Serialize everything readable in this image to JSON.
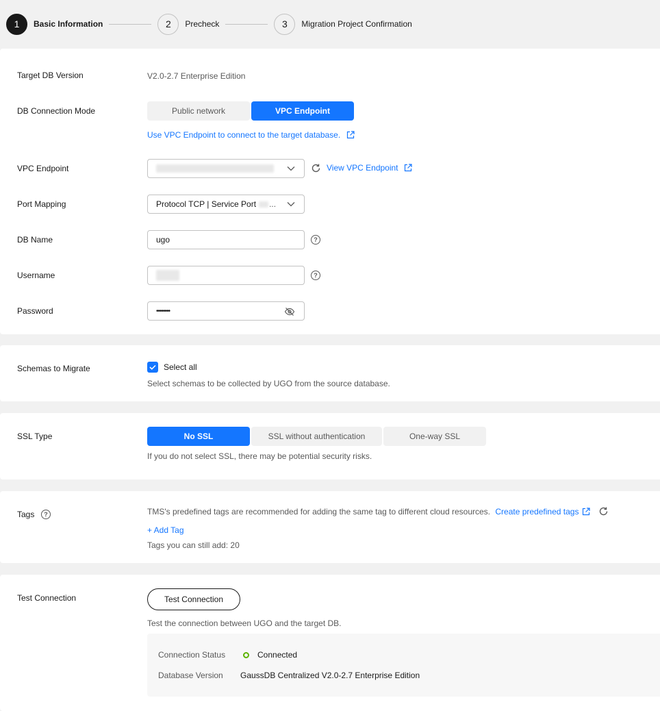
{
  "steps": [
    {
      "num": "1",
      "label": "Basic Information"
    },
    {
      "num": "2",
      "label": "Precheck"
    },
    {
      "num": "3",
      "label": "Migration Project Confirmation"
    }
  ],
  "target_db": {
    "version_label": "Target DB Version",
    "version_value": "V2.0-2.7 Enterprise Edition",
    "mode_label": "DB Connection Mode",
    "mode_options": [
      "Public network",
      "VPC Endpoint"
    ],
    "mode_selected": "VPC Endpoint",
    "mode_help_link": "Use VPC Endpoint to connect to the target database.",
    "vpc_label": "VPC Endpoint",
    "vpc_view_link": "View VPC Endpoint",
    "port_label": "Port Mapping",
    "port_value": "Protocol TCP | Service Port",
    "dbname_label": "DB Name",
    "dbname_value": "ugo",
    "username_label": "Username",
    "password_label": "Password",
    "password_value": "••••••••"
  },
  "schemas": {
    "label": "Schemas to Migrate",
    "select_all": "Select all",
    "select_all_checked": true,
    "hint": "Select schemas to be collected by UGO from the source database."
  },
  "ssl": {
    "label": "SSL Type",
    "options": [
      "No SSL",
      "SSL without authentication",
      "One-way SSL"
    ],
    "selected": "No SSL",
    "hint": "If you do not select SSL, there may be potential security risks."
  },
  "tags": {
    "label": "Tags",
    "description": "TMS's predefined tags are recommended for adding the same tag to different cloud resources.",
    "create_link": "Create predefined tags",
    "add_tag": "+ Add Tag",
    "remaining": "Tags you can still add: 20"
  },
  "test_connection": {
    "label": "Test Connection",
    "button": "Test Connection",
    "hint": "Test the connection between UGO and the target DB.",
    "status_key": "Connection Status",
    "status_value": "Connected",
    "version_key": "Database Version",
    "version_value": "GaussDB Centralized V2.0-2.7 Enterprise Edition"
  },
  "colors": {
    "accent": "#1476ff",
    "success": "#5cb300",
    "text": "#191919",
    "muted": "#595959"
  },
  "icons": [
    "external-link-icon",
    "chevron-down-icon",
    "refresh-icon",
    "question-icon",
    "eye-off-icon",
    "check-icon"
  ]
}
